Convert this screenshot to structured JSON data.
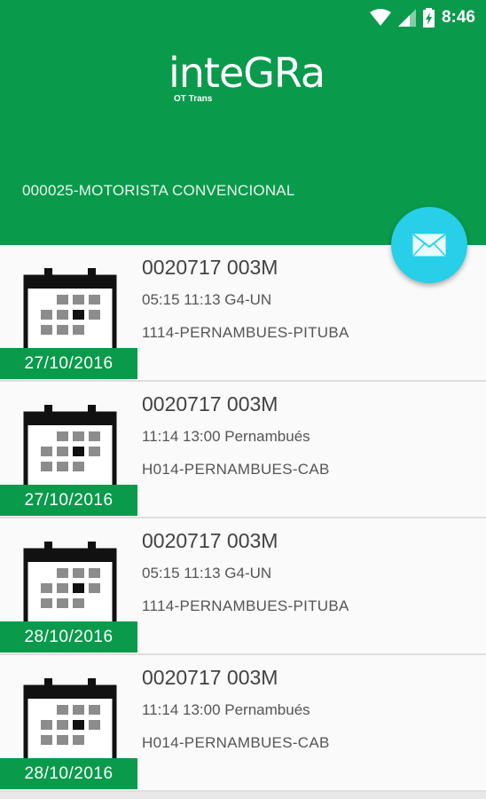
{
  "status_bar": {
    "time": "8:46",
    "icons": [
      "wifi-icon",
      "signal-icon",
      "battery-charging-icon"
    ]
  },
  "app": {
    "logo_main": "inteGRa",
    "logo_sub": "OT Trans",
    "driver": "000025-MOTORISTA CONVENCIONAL",
    "fab_icon": "mail-icon",
    "accent": "#0a9a4b",
    "fab_color": "#27cfe8"
  },
  "trips": [
    {
      "date": "27/10/2016",
      "code": "0020717 003M",
      "schedule": "05:15 11:13 G4-UN",
      "route": "1114-PERNAMBUES-PITUBA"
    },
    {
      "date": "27/10/2016",
      "code": "0020717 003M",
      "schedule": "11:14 13:00 Pernambués",
      "route": "H014-PERNAMBUES-CAB"
    },
    {
      "date": "28/10/2016",
      "code": "0020717 003M",
      "schedule": "05:15 11:13 G4-UN",
      "route": "1114-PERNAMBUES-PITUBA"
    },
    {
      "date": "28/10/2016",
      "code": "0020717 003M",
      "schedule": "11:14 13:00 Pernambués",
      "route": "H014-PERNAMBUES-CAB"
    }
  ]
}
